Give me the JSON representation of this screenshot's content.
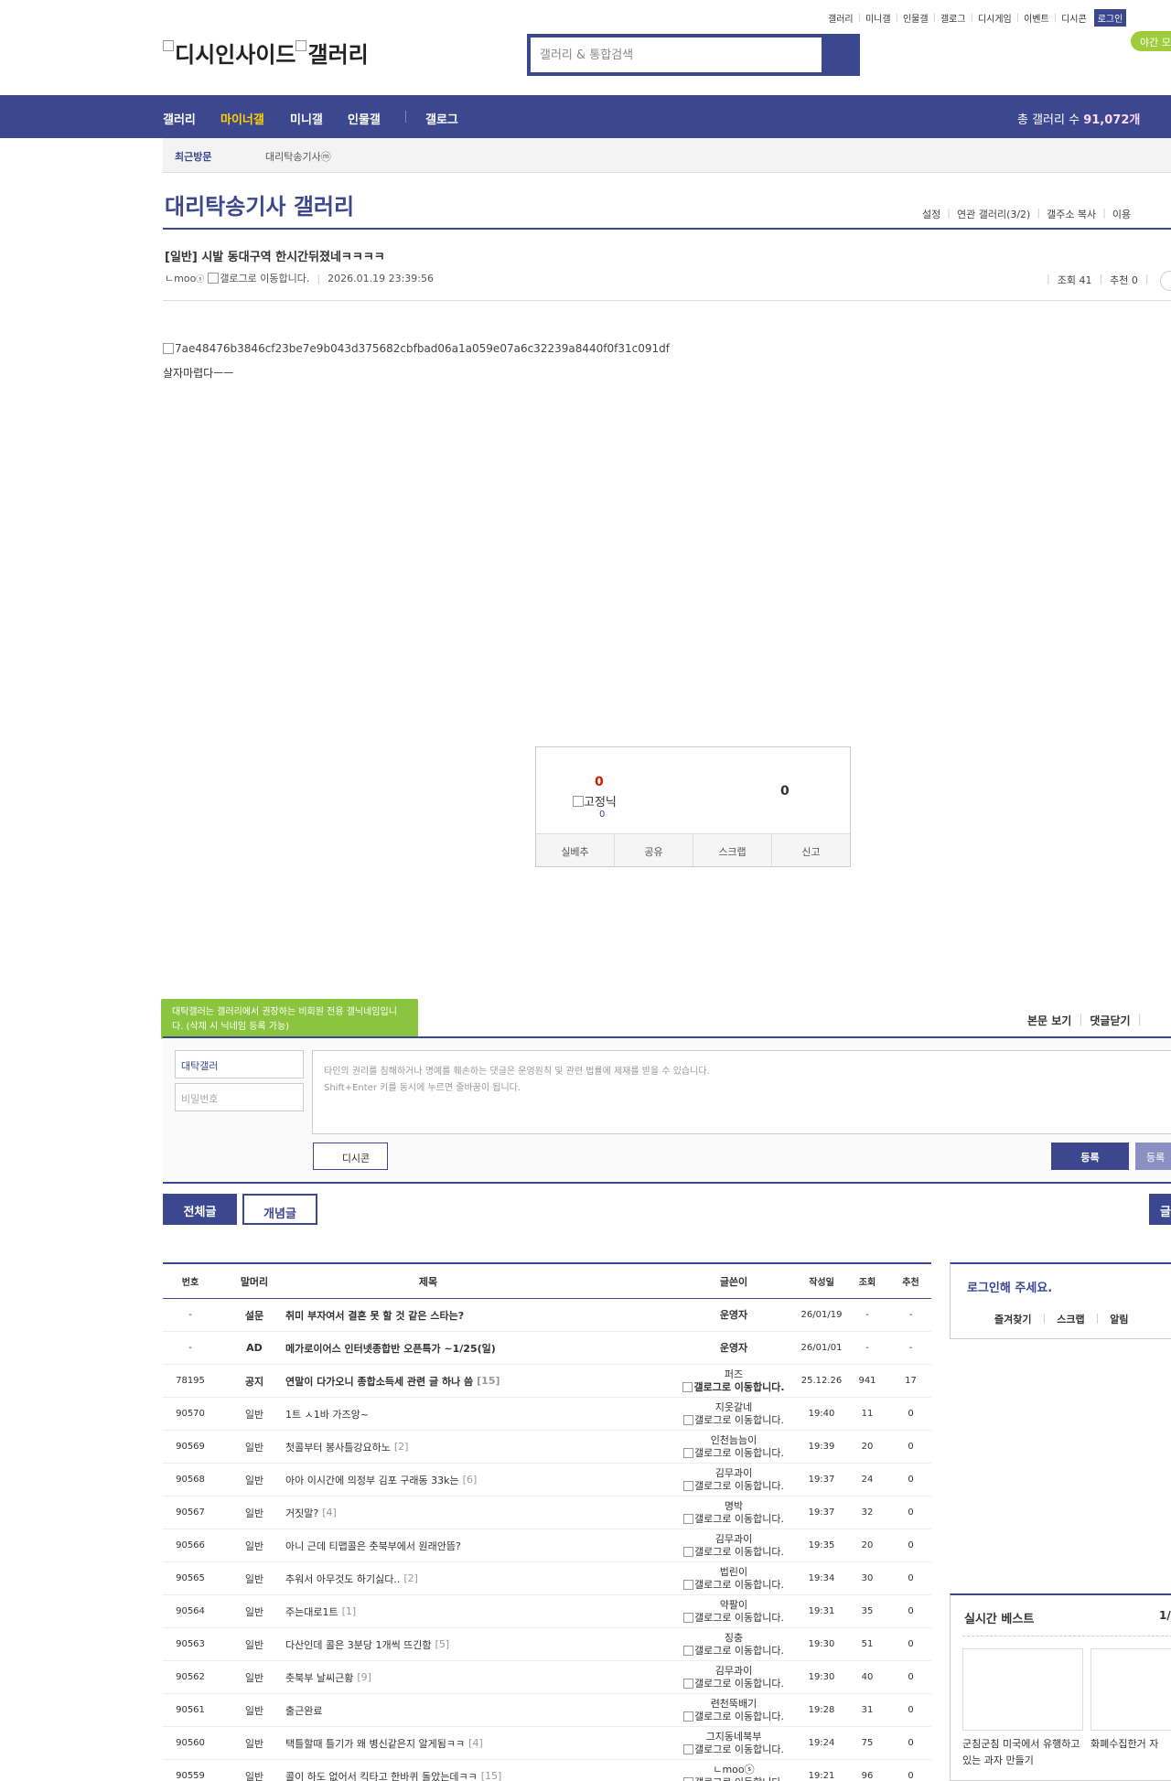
{
  "topnav": [
    "갤러리",
    "미니갤",
    "인물갤",
    "갤로그",
    "디시게임",
    "이벤트",
    "디시콘"
  ],
  "login_label": "로그인",
  "night_label": "야간 모",
  "logo_text_1": "디시인사이드",
  "logo_text_2": "갤러리",
  "search_placeholder": "갤러리 & 통합검색",
  "gnb": {
    "items": [
      "갤러리",
      "마이너갤",
      "미니갤",
      "인물갤",
      "갤로그"
    ],
    "count_label": "총 갤러리 수",
    "count_value": "91,072개"
  },
  "recent": {
    "title": "최근방문",
    "gallery": "대리탁송기사ⓜ"
  },
  "gallery_title": "대리탁송기사 갤러리",
  "gallery_menu": [
    "설정",
    "연관 갤러리(3/2)",
    "갤주소 복사",
    "이용"
  ],
  "post": {
    "title": "[일반] 시발 동대구역 한시간뒤졌네ㅋㅋㅋㅋ",
    "author": "ㄴmoo",
    "author_icon": "ⓢ",
    "gallog_alt": "갤로그로 이동합니다.",
    "date": "2026.01.19 23:39:56",
    "views": "조회 41",
    "recommend": "추천 0",
    "image_alt": "7ae48476b3846cf23be7e9b043d375682cbfbad06a1a059e07a6c32239a8440f0f31c091df",
    "body": "살자마렵다ㅡㅡ"
  },
  "rec": {
    "up": "0",
    "nick_alt": "고정닉",
    "fix_count": "0",
    "down": "0",
    "buttons": [
      "실베추",
      "공유",
      "스크랩",
      "신고"
    ]
  },
  "comment": {
    "tip": "대탁갤러는 갤러리에서 권장하는 비회원 전용 갤닉네임입니다. (삭제 시 닉네임 등록 가능)",
    "menu": [
      "본문 보기",
      "댓글닫기"
    ],
    "nick_value": "대탁갤러",
    "pw_placeholder": "비밀번호",
    "textarea_line1": "타인의 권리를 침해하거나 명예를 훼손하는 댓글은 운영원칙 및 관련 법률에 제재를 받을 수 있습니다.",
    "textarea_line2": "Shift+Enter 키를 동시에 누르면 줄바꿈이 됩니다.",
    "dccon": "디시콘",
    "submit": "등록",
    "submit2": "등록"
  },
  "tabs": {
    "all": "전체글",
    "concept": "개념글",
    "right": "글"
  },
  "list": {
    "headers": [
      "번호",
      "말머리",
      "제목",
      "글쓴이",
      "작성일",
      "조회",
      "추천"
    ],
    "rows": [
      {
        "num": "-",
        "sub": "설문",
        "title": "취미 부자여서 결혼 못 할 것 같은 스타는?",
        "rep": "",
        "writer": "운영자",
        "gallog": "",
        "date": "26/01/19",
        "views": "-",
        "rec": "-",
        "notice": true
      },
      {
        "num": "-",
        "sub": "AD",
        "title": "메가로이어스 인터넷종합반 오픈특가 ~1/25(일)",
        "rep": "",
        "writer": "운영자",
        "gallog": "",
        "date": "26/01/01",
        "views": "-",
        "rec": "-",
        "notice": true
      },
      {
        "num": "78195",
        "sub": "공지",
        "title": "연말이 다가오니 종합소득세 관련 글 하나 씀",
        "rep": "[15]",
        "writer": "퍼즈",
        "gallog": "갤로그로 이동합니다.",
        "date": "25.12.26",
        "views": "941",
        "rec": "17",
        "notice": true
      },
      {
        "num": "90570",
        "sub": "일반",
        "title": "1트 ㅅ1바 가즈앙~",
        "rep": "",
        "writer": "지옷갈네",
        "gallog": "갤로그로 이동합니다.",
        "date": "19:40",
        "views": "11",
        "rec": "0"
      },
      {
        "num": "90569",
        "sub": "일반",
        "title": "첫콜부터 봉사틀강요하노",
        "rep": "[2]",
        "writer": "인천늠늠이",
        "gallog": "갤로그로 이동합니다.",
        "date": "19:39",
        "views": "20",
        "rec": "0"
      },
      {
        "num": "90568",
        "sub": "일반",
        "title": "아아 이시간에 의정부 김포 구래동 33k는",
        "rep": "[6]",
        "writer": "김무과이",
        "gallog": "갤로그로 이동합니다.",
        "date": "19:37",
        "views": "24",
        "rec": "0"
      },
      {
        "num": "90567",
        "sub": "일반",
        "title": "거짓말?",
        "rep": "[4]",
        "writer": "명박",
        "gallog": "갤로그로 이동합니다.",
        "date": "19:37",
        "views": "32",
        "rec": "0"
      },
      {
        "num": "90566",
        "sub": "일반",
        "title": "아니 근데 티맵콜은 춧북부에서 원래안뜸?",
        "rep": "",
        "writer": "김무과이",
        "gallog": "갤로그로 이동합니다.",
        "date": "19:35",
        "views": "20",
        "rec": "0"
      },
      {
        "num": "90565",
        "sub": "일반",
        "title": "추워서 아무것도 하기싫다..",
        "rep": "[2]",
        "writer": "법린이",
        "gallog": "갤로그로 이동합니다.",
        "date": "19:34",
        "views": "30",
        "rec": "0"
      },
      {
        "num": "90564",
        "sub": "일반",
        "title": "주는대로1트",
        "rep": "[1]",
        "writer": "약팔이",
        "gallog": "갤로그로 이동합니다.",
        "date": "19:31",
        "views": "35",
        "rec": "0"
      },
      {
        "num": "90563",
        "sub": "일반",
        "title": "다산인데 콜은 3분당 1개씩 뜨긴함",
        "rep": "[5]",
        "writer": "징충",
        "gallog": "갤로그로 이동합니다.",
        "date": "19:30",
        "views": "51",
        "rec": "0"
      },
      {
        "num": "90562",
        "sub": "일반",
        "title": "춧북부 날씨근황",
        "rep": "[9]",
        "writer": "김무과이",
        "gallog": "갤로그로 이동합니다.",
        "date": "19:30",
        "views": "40",
        "rec": "0"
      },
      {
        "num": "90561",
        "sub": "일반",
        "title": "출근완료",
        "rep": "",
        "writer": "련천뚝배기",
        "gallog": "갤로그로 이동합니다.",
        "date": "19:28",
        "views": "31",
        "rec": "0"
      },
      {
        "num": "90560",
        "sub": "일반",
        "title": "택틀할때 틀기가 왜 병신같은지 알게됨ㅋㅋ",
        "rep": "[4]",
        "writer": "그지동네북부",
        "gallog": "갤로그로 이동합니다.",
        "date": "19:24",
        "views": "75",
        "rec": "0"
      },
      {
        "num": "90559",
        "sub": "일반",
        "title": "콜이 하도 없어서 킥타고 한바퀴 돌았는데ㅋㅋ",
        "rep": "[15]",
        "writer": "ㄴmooⓢ",
        "gallog": "갤로그로 이동합니다.",
        "date": "19:21",
        "views": "96",
        "rec": "0"
      }
    ]
  },
  "side_login": {
    "title": "로그인해 주세요.",
    "menu": [
      "즐겨찾기",
      "스크랩",
      "알림"
    ]
  },
  "side_best": {
    "title": "실시간 베스트",
    "page": "1/",
    "items": [
      "군침군침 미국에서 유행하고 있는 과자 만들기",
      "화폐수집한거 자"
    ]
  },
  "colors": {
    "brand": "#3b4890",
    "accent_yellow": "#ffd200",
    "tip_green": "#8bc53f",
    "up_red": "#d31900"
  }
}
